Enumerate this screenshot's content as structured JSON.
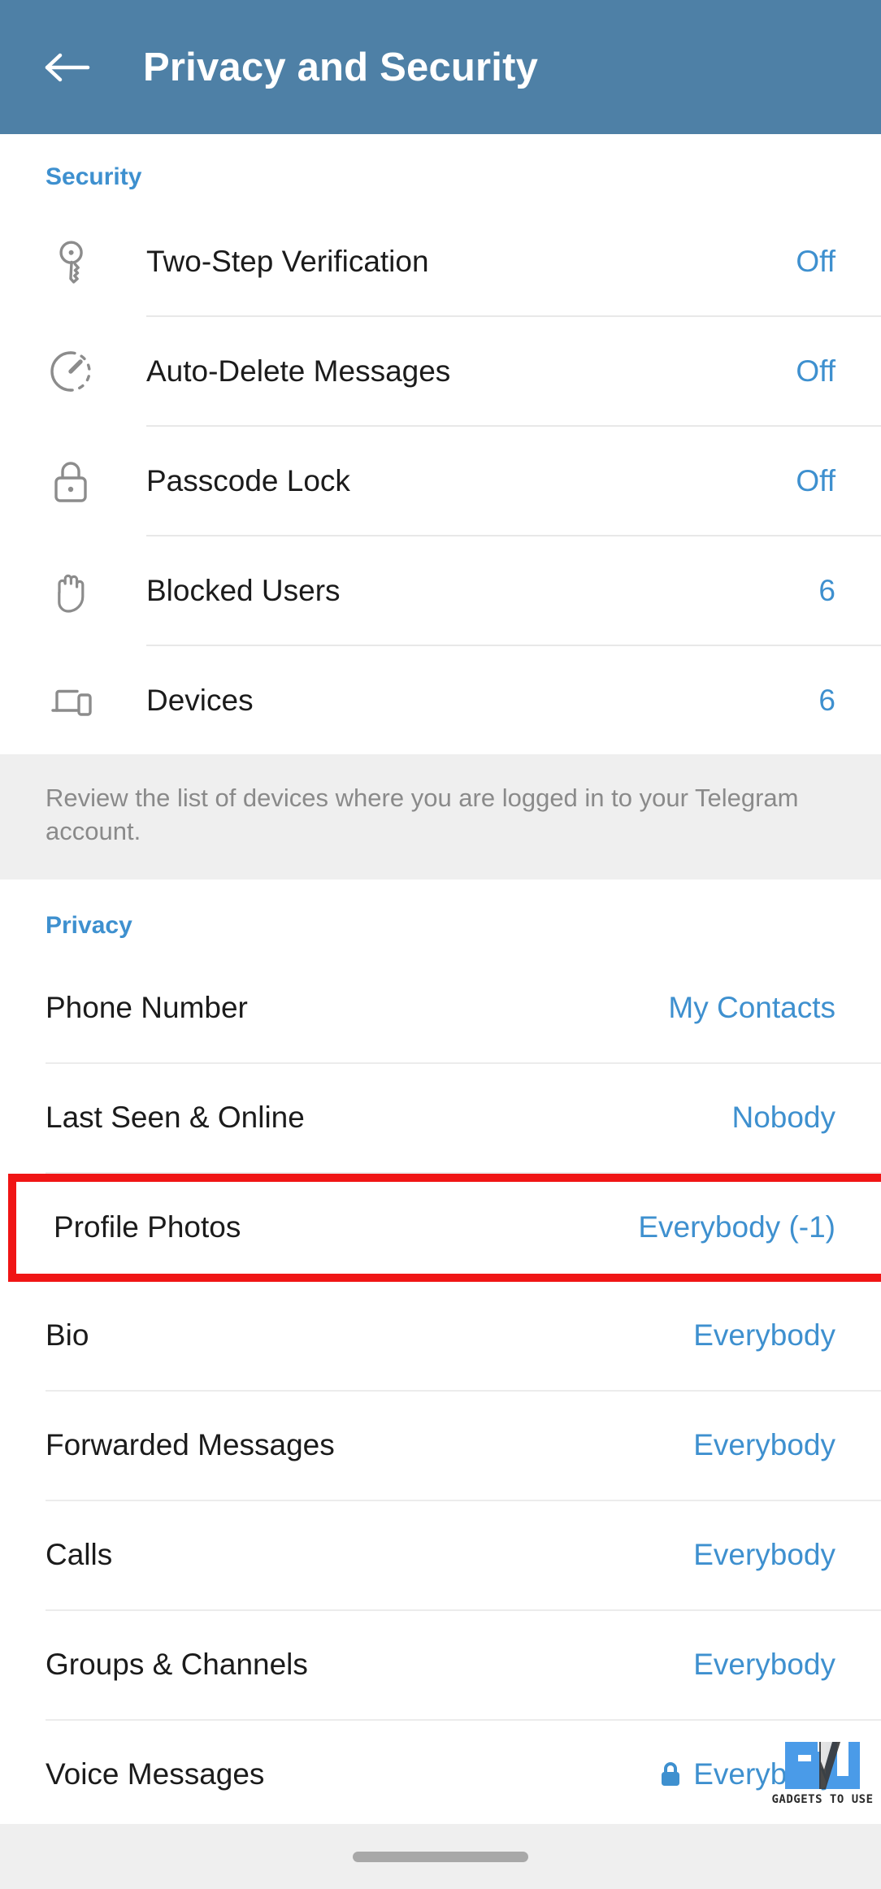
{
  "header": {
    "title": "Privacy and Security",
    "back_icon": "arrow-left-icon",
    "background_color": "#4E80A6"
  },
  "colors": {
    "accent_blue": "#3E90CF",
    "header_blue": "#4E80A6",
    "highlight_red": "#F01515",
    "note_background": "#EFEFEF",
    "text_primary": "#1B1B1B",
    "text_muted": "#8A8A8A"
  },
  "security": {
    "section_label": "Security",
    "items": [
      {
        "icon": "key-icon",
        "label": "Two-Step Verification",
        "value": "Off"
      },
      {
        "icon": "timer-clock-icon",
        "label": "Auto-Delete Messages",
        "value": "Off"
      },
      {
        "icon": "padlock-icon",
        "label": "Passcode Lock",
        "value": "Off"
      },
      {
        "icon": "hand-stop-icon",
        "label": "Blocked Users",
        "value": "6"
      },
      {
        "icon": "devices-icon",
        "label": "Devices",
        "value": "6"
      }
    ],
    "note": "Review the list of devices where you are logged in to your Telegram account."
  },
  "privacy": {
    "section_label": "Privacy",
    "items": [
      {
        "label": "Phone Number",
        "value": "My Contacts",
        "highlighted": false,
        "lock": false
      },
      {
        "label": "Last Seen & Online",
        "value": "Nobody",
        "highlighted": false,
        "lock": false
      },
      {
        "label": "Profile Photos",
        "value": "Everybody (-1)",
        "highlighted": true,
        "lock": false
      },
      {
        "label": "Bio",
        "value": "Everybody",
        "highlighted": false,
        "lock": false
      },
      {
        "label": "Forwarded Messages",
        "value": "Everybody",
        "highlighted": false,
        "lock": false
      },
      {
        "label": "Calls",
        "value": "Everybody",
        "highlighted": false,
        "lock": false
      },
      {
        "label": "Groups & Channels",
        "value": "Everybody",
        "highlighted": false,
        "lock": false
      },
      {
        "label": "Voice Messages",
        "value": "Everybody",
        "highlighted": false,
        "lock": true
      }
    ]
  },
  "watermark": {
    "text": "GADGETS TO USE",
    "mark_color": "#4A9BE8"
  },
  "navbar": {
    "gesture_handle": "home-indicator"
  }
}
